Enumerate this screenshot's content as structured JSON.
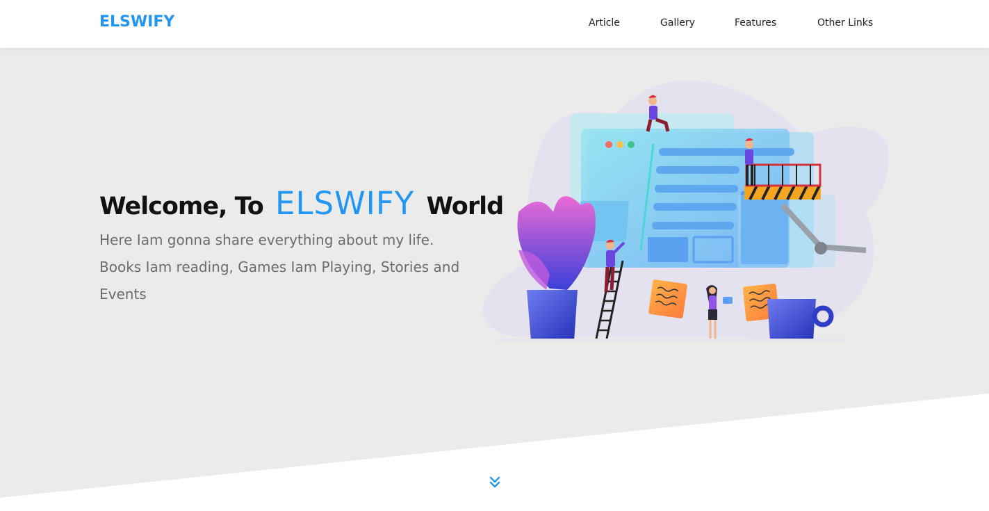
{
  "header": {
    "logo": "ELSWIFY",
    "nav": [
      {
        "label": "Article"
      },
      {
        "label": "Gallery"
      },
      {
        "label": "Features"
      },
      {
        "label": "Other Links"
      }
    ]
  },
  "hero": {
    "headline_prefix": "Welcome, To",
    "headline_brand": "ELSWIFY",
    "headline_suffix": "World",
    "tagline": "Here Iam gonna share everything about my life. Books Iam reading, Games Iam Playing, Stories and Events",
    "illustration_icon": "web-design-team-illustration",
    "scroll_icon": "double-chevron-down-icon"
  },
  "colors": {
    "brand": "#2196f3",
    "hero_bg": "#ebebeb",
    "text_dark": "#111111",
    "text_muted": "#6b6b6b"
  }
}
